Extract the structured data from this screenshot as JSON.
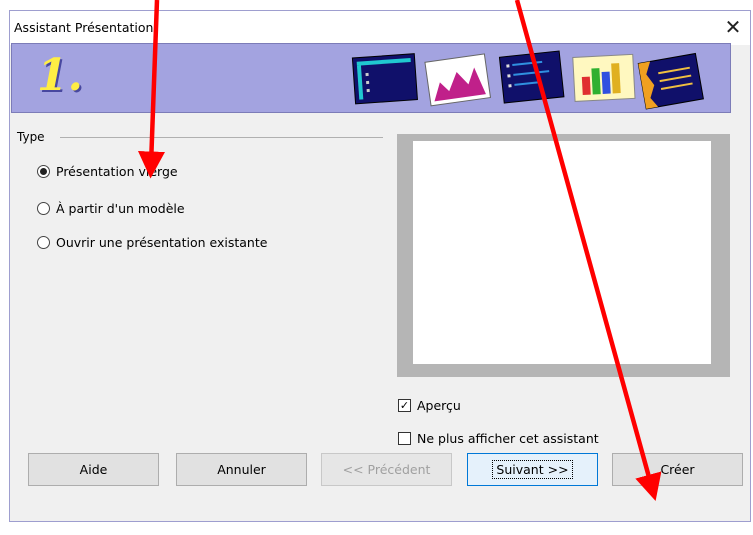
{
  "window": {
    "title": "Assistant Présentation",
    "close_symbol": "✕"
  },
  "banner": {
    "step_number": "1."
  },
  "type_group": {
    "label": "Type",
    "options": [
      {
        "label": "Présentation vierge",
        "selected": true
      },
      {
        "label": "À partir d'un modèle",
        "selected": false
      },
      {
        "label": "Ouvrir une présentation existante",
        "selected": false
      }
    ]
  },
  "preview": {
    "checkbox_label": "Aperçu",
    "checked": true
  },
  "dont_show": {
    "checkbox_label": "Ne plus afficher cet assistant",
    "checked": false
  },
  "buttons": {
    "help": "Aide",
    "cancel": "Annuler",
    "previous": "<< Précédent",
    "next": "Suivant >>",
    "create": "Créer"
  },
  "colors": {
    "annotation_arrow": "#ff0000",
    "banner": "#a3a3e0"
  }
}
